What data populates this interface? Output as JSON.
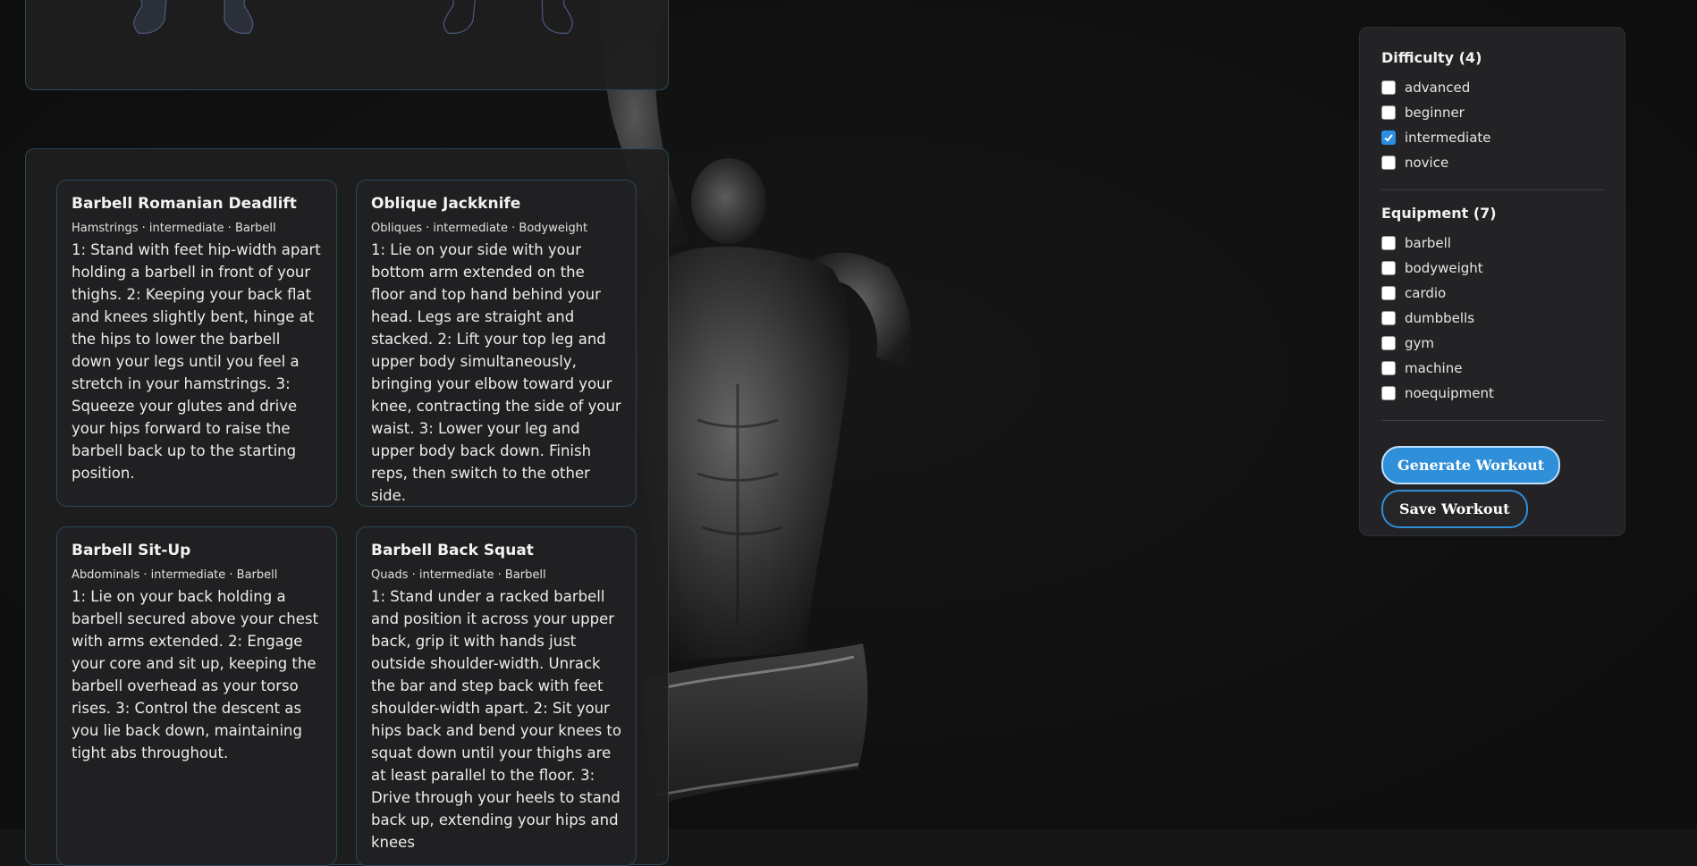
{
  "exercises": [
    {
      "title": "Barbell Romanian Deadlift",
      "meta": "Hamstrings · intermediate · Barbell",
      "instructions": "1: Stand with feet hip-width apart holding a barbell in front of your thighs. 2: Keeping your back flat and knees slightly bent, hinge at the hips to lower the barbell down your legs until you feel a stretch in your hamstrings. 3: Squeeze your glutes and drive your hips forward to raise the barbell back up to the starting position."
    },
    {
      "title": "Oblique Jackknife",
      "meta": "Obliques · intermediate · Bodyweight",
      "instructions": "1: Lie on your side with your bottom arm extended on the floor and top hand behind your head. Legs are straight and stacked. 2: Lift your top leg and upper body simultaneously, bringing your elbow toward your knee, contracting the side of your waist. 3: Lower your leg and upper body back down. Finish reps, then switch to the other side."
    },
    {
      "title": "Barbell Sit-Up",
      "meta": "Abdominals · intermediate · Barbell",
      "instructions": "1: Lie on your back holding a barbell secured above your chest with arms extended. 2: Engage your core and sit up, keeping the barbell overhead as your torso rises. 3: Control the descent as you lie back down, maintaining tight abs throughout."
    },
    {
      "title": "Barbell Back Squat",
      "meta": "Quads · intermediate · Barbell",
      "instructions": "1: Stand under a racked barbell and position it across your upper back, grip it with hands just outside shoulder-width. Unrack the bar and step back with feet shoulder-width apart. 2: Sit your hips back and bend your knees to squat down until your thighs are at least parallel to the floor. 3: Drive through your heels to stand back up, extending your hips and knees"
    }
  ],
  "filters": {
    "difficulty_heading": "Difficulty (4)",
    "difficulty": [
      {
        "label": "advanced",
        "checked": false
      },
      {
        "label": "beginner",
        "checked": false
      },
      {
        "label": "intermediate",
        "checked": true
      },
      {
        "label": "novice",
        "checked": false
      }
    ],
    "equipment_heading": "Equipment (7)",
    "equipment": [
      {
        "label": "barbell",
        "checked": false
      },
      {
        "label": "bodyweight",
        "checked": false
      },
      {
        "label": "cardio",
        "checked": false
      },
      {
        "label": "dumbbells",
        "checked": false
      },
      {
        "label": "gym",
        "checked": false
      },
      {
        "label": "machine",
        "checked": false
      },
      {
        "label": "noequipment",
        "checked": false
      }
    ],
    "generate_label": "Generate Workout",
    "save_label": "Save Workout"
  },
  "colors": {
    "accent": "#2f8fd8",
    "panel_border": "#29485a",
    "background": "#161616"
  }
}
